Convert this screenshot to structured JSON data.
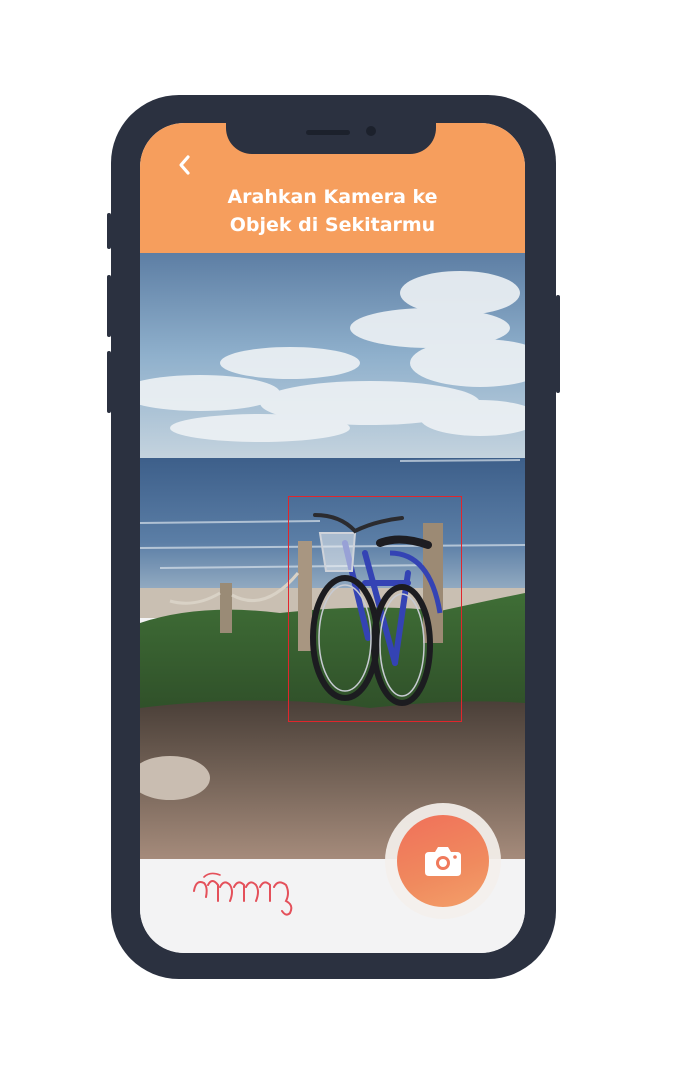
{
  "header": {
    "title": "Arahkan Kamera ke\nObjek di Sekitarmu",
    "back_icon": "chevron-left-icon"
  },
  "viewfinder": {
    "scene": "bicycle-on-beach",
    "detection_color": "#e0262c"
  },
  "footer": {
    "script_text": "ꦱꦼꦥꦺꦢ",
    "shutter_icon": "camera-icon"
  },
  "colors": {
    "header": "#f69e5d",
    "phone_frame": "#2b3140",
    "shutter": "#f0705a",
    "footer": "#f3f3f4"
  }
}
